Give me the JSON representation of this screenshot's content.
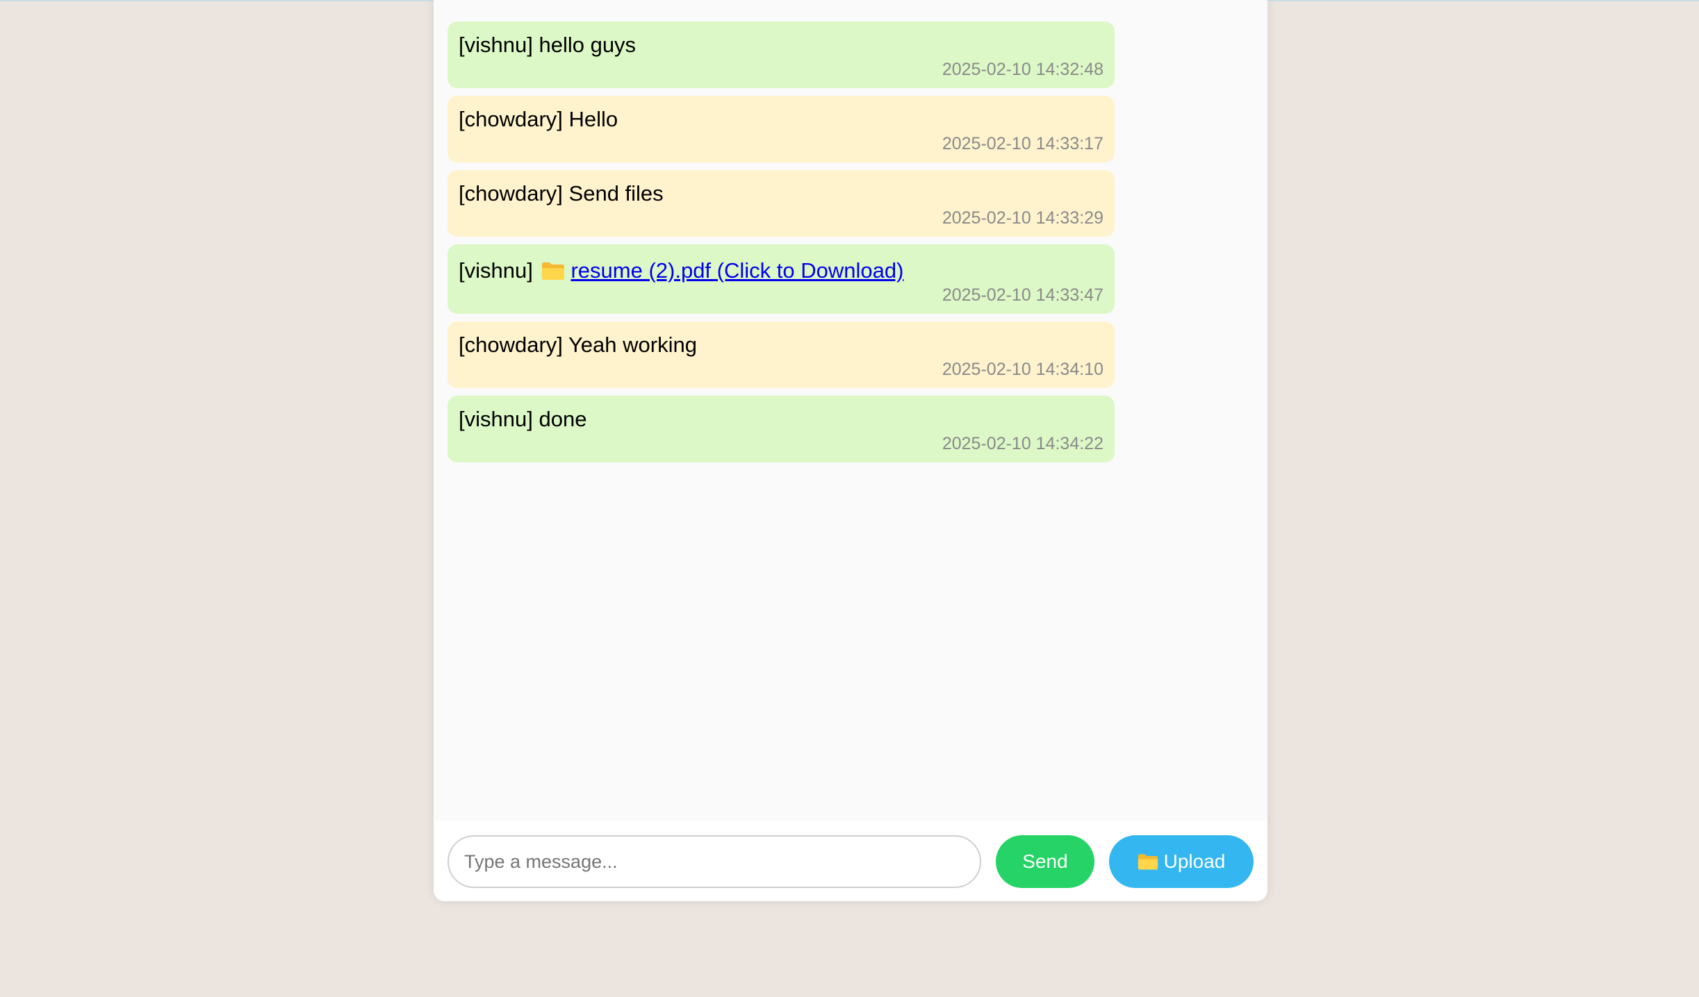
{
  "colors": {
    "page_background": "#ece5df",
    "panel_background": "#fafafa",
    "own_message_bubble": "#dcf8c6",
    "other_message_bubble": "#fff3cd",
    "timestamp_text": "#8a8a8a",
    "link_text": "#0000ee",
    "send_button": "#25d366",
    "upload_button": "#34b7f1"
  },
  "messages": [
    {
      "sender": "[vishnu]",
      "text": "hello guys",
      "timestamp": "2025-02-10 14:32:48",
      "side": "out"
    },
    {
      "sender": "[chowdary]",
      "text": "Hello",
      "timestamp": "2025-02-10 14:33:17",
      "side": "in"
    },
    {
      "sender": "[chowdary]",
      "text": "Send files",
      "timestamp": "2025-02-10 14:33:29",
      "side": "in"
    },
    {
      "sender": "[vishnu]",
      "file_icon": "folder-icon",
      "file_link_text": "resume (2).pdf (Click to Download)",
      "timestamp": "2025-02-10 14:33:47",
      "side": "out"
    },
    {
      "sender": "[chowdary]",
      "text": "Yeah working",
      "timestamp": "2025-02-10 14:34:10",
      "side": "in"
    },
    {
      "sender": "[vishnu]",
      "text": "done",
      "timestamp": "2025-02-10 14:34:22",
      "side": "out"
    }
  ],
  "composer": {
    "input_placeholder": "Type a message...",
    "input_value": "",
    "send_label": "Send",
    "upload_icon": "folder-icon",
    "upload_label": "Upload"
  }
}
